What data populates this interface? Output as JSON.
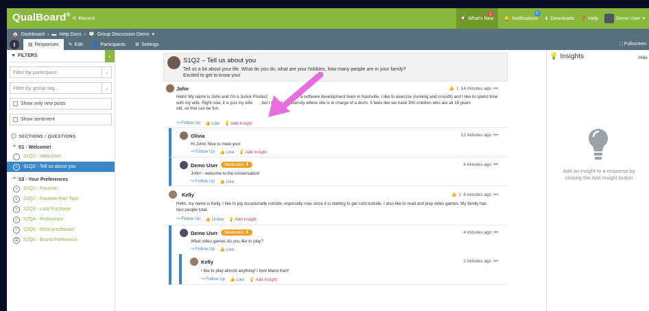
{
  "topbar": {
    "logo": "QualBoard",
    "logo_mark": "®",
    "recent": "Recent",
    "whats_new": "What's New",
    "whats_new_badge": "1",
    "notifications": "Notifications",
    "notifications_badge": "0",
    "downloads": "Downloads",
    "help": "Help",
    "user": "Demo User"
  },
  "breadcrumb": {
    "dashboard": "Dashboard",
    "help_docs": "Help Docs",
    "discussion": "Group Discussion Demo"
  },
  "tabs": {
    "icon_letter": "t",
    "responses": "Responses",
    "edit": "Edit",
    "participants": "Participants",
    "settings": "Settings",
    "fullscreen": "Fullscreen"
  },
  "filters": {
    "heading": "FILTERS",
    "collapse": "‹",
    "participant_placeholder": "Filter by participant",
    "group_placeholder": "Filter by group tag...",
    "show_new": "Show only new posts",
    "show_sentiment": "Show sentiment"
  },
  "sections": {
    "heading": "SECTIONS / QUESTIONS",
    "s1": {
      "title": "S1 - Welcome!",
      "questions": [
        {
          "label": "S1Q1 - Welcome!",
          "icon": "!"
        },
        {
          "label": "S1Q2 - Tell us about you",
          "icon": "≡"
        }
      ]
    },
    "s2": {
      "title": "S2 - Your Preferences",
      "questions": [
        {
          "label": "S2Q1 - Favorite",
          "icon": "≡"
        },
        {
          "label": "S2Q2 - Favorite Part Two!",
          "icon": "≡"
        },
        {
          "label": "S2Q3 - Last Purchase",
          "icon": "≡"
        },
        {
          "label": "S2Q4 - Preference",
          "icon": "✓"
        },
        {
          "label": "S2Q5 - Most purchased",
          "icon": "✓"
        },
        {
          "label": "S2Q6 - Brand Preference",
          "icon": "☰"
        }
      ]
    }
  },
  "question": {
    "title": "S1Q2 – Tell us about you",
    "line1": "Tell us a bit about your life. What do you do, what are your hobbies, how many people are in your family?",
    "line2": "Excited to get to know you!"
  },
  "actions": {
    "follow_up": "Follow Up",
    "like": "Like",
    "unlike": "Unlike",
    "add_insight": "Add Insight",
    "more": "•••",
    "moderator": "Moderator"
  },
  "posts": {
    "john": {
      "name": "John",
      "likes": "1",
      "time": "14 minutes ago",
      "text1": "Hello! My name is John and I'm a Junior Product",
      "text1b": "r a software development team in Nashville. I like to exercise (running and crossfit) and I like to spend time",
      "text2a": "with my wife. Right now, it is just my wife",
      "text2b": ", but I live at a university where she is in charge of a dorm. It feels like we have 300 children who are all 18 years",
      "text3": "old, so that can be fun."
    },
    "olivia": {
      "name": "Olivia",
      "time": "12 minutes ago",
      "text": "Hi John! Nice to meet you!"
    },
    "demo1": {
      "name": "Demo User",
      "time": "4 minutes ago",
      "text": "John! - welcome to the conversation!"
    },
    "kelly1": {
      "name": "Kelly",
      "likes": "1",
      "time": "6 minutes ago",
      "text1": "Hello, my name is Kelly. I like to jog occasionally outside, especially now since it is starting to get cold outside. I also like to read and play video games. My family has",
      "text2": "four people total."
    },
    "demo2": {
      "name": "Demo User",
      "time": "4 minutes ago",
      "text": "What video games do you like to play?"
    },
    "kelly2": {
      "name": "Kelly",
      "time": "2 minutes ago",
      "text": "I like to play almost anything! I love Mario Kart!"
    }
  },
  "insights": {
    "title": "Insights",
    "hide": "Hide",
    "empty_line1": "Add an insight to a response by",
    "empty_line2": "clicking the Add Insight button"
  },
  "colors": {
    "brand_green": "#8ab83d",
    "subbar": "#58707d",
    "active_blue": "#3b86c6",
    "insight_pink": "#d6336c",
    "moderator_orange": "#f0a024",
    "annotation_arrow": "#e86ee0"
  }
}
